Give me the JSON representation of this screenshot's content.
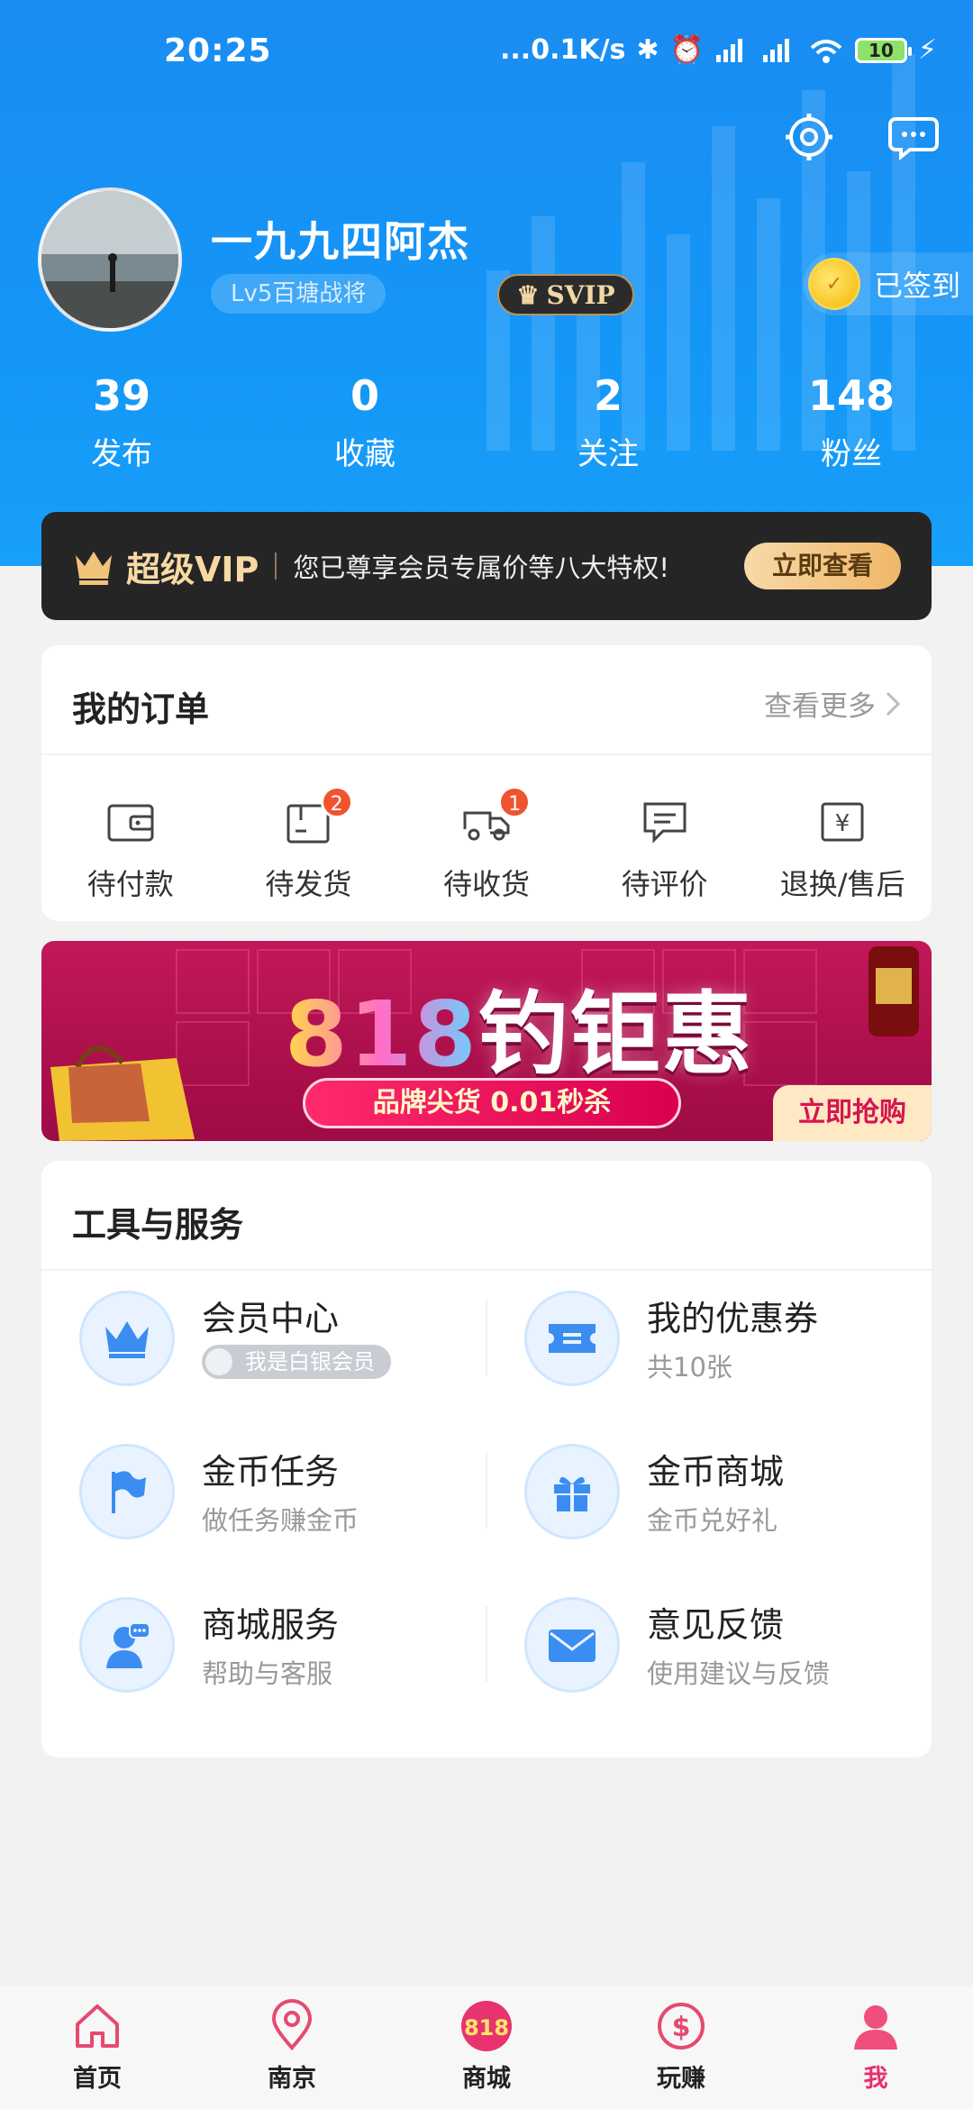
{
  "status_bar": {
    "time": "20:25",
    "net_speed": "...0.1K/s",
    "battery": "10"
  },
  "header": {
    "username": "一九九四阿杰",
    "level": "Lv5百塘战将",
    "svip": "SVIP",
    "signin": "已签到",
    "colors": {
      "bg": "#1a8cf2"
    }
  },
  "stats": [
    {
      "num": "39",
      "label": "发布"
    },
    {
      "num": "0",
      "label": "收藏"
    },
    {
      "num": "2",
      "label": "关注"
    },
    {
      "num": "148",
      "label": "粉丝"
    }
  ],
  "vip": {
    "title": "超级VIP",
    "desc": "您已尊享会员专属价等八大特权!",
    "button": "立即查看"
  },
  "orders": {
    "title": "我的订单",
    "more": "查看更多",
    "items": [
      {
        "label": "待付款",
        "badge": ""
      },
      {
        "label": "待发货",
        "badge": "2"
      },
      {
        "label": "待收货",
        "badge": "1"
      },
      {
        "label": "待评价",
        "badge": ""
      },
      {
        "label": "退换/售后",
        "badge": ""
      }
    ]
  },
  "banner": {
    "num": "818",
    "title": "钓钜惠",
    "pill": "品牌尖货 0.01秒杀",
    "cta": "立即抢购"
  },
  "tools": {
    "title": "工具与服务",
    "items": [
      {
        "title": "会员中心",
        "sub": "我是白银会员",
        "icon": "crown-icon"
      },
      {
        "title": "我的优惠券",
        "sub": "共10张",
        "icon": "coupon-icon"
      },
      {
        "title": "金币任务",
        "sub": "做任务赚金币",
        "icon": "flag-icon"
      },
      {
        "title": "金币商城",
        "sub": "金币兑好礼",
        "icon": "gift-icon"
      },
      {
        "title": "商城服务",
        "sub": "帮助与客服",
        "icon": "service-icon"
      },
      {
        "title": "意见反馈",
        "sub": "使用建议与反馈",
        "icon": "mail-icon"
      }
    ]
  },
  "tabbar": [
    {
      "label": "首页",
      "icon": "home-icon"
    },
    {
      "label": "南京",
      "icon": "location-icon"
    },
    {
      "label": "商城",
      "icon": "mall-818-icon"
    },
    {
      "label": "玩赚",
      "icon": "dollar-icon"
    },
    {
      "label": "我",
      "icon": "profile-icon"
    }
  ]
}
